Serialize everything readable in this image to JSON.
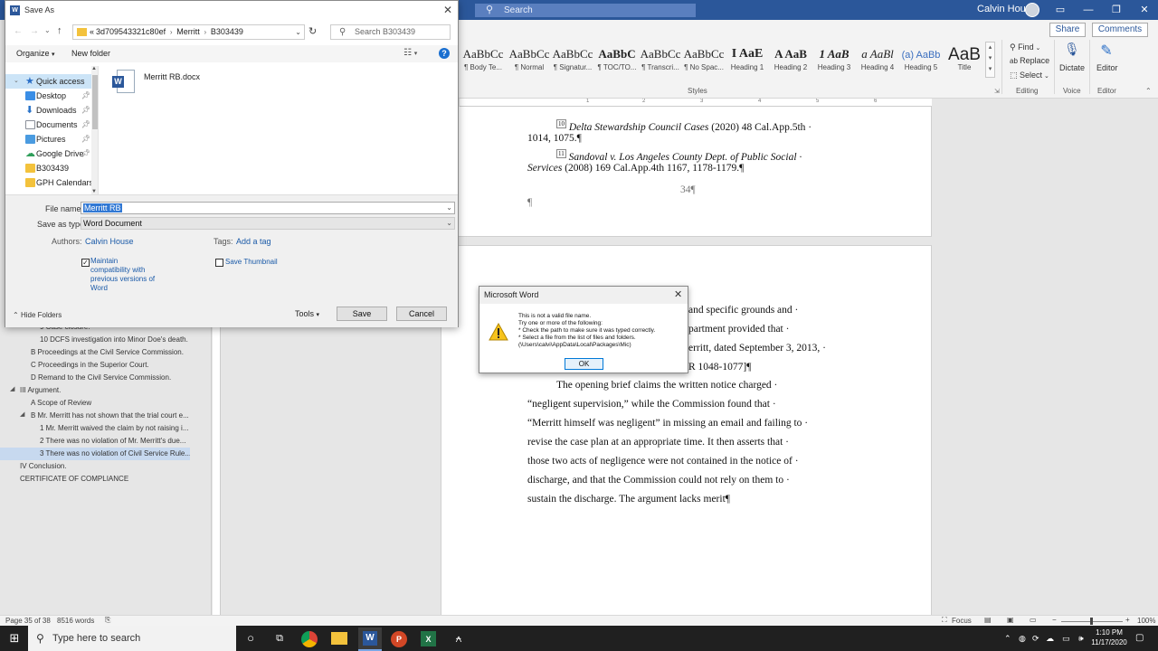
{
  "word": {
    "search_placeholder": "Search",
    "user_name": "Calvin House",
    "share": "Share",
    "comments": "Comments",
    "styles": [
      {
        "preview": "AaBbCc",
        "name": "¶ Body Te..."
      },
      {
        "preview": "AaBbCc",
        "name": "¶ Normal"
      },
      {
        "preview": "AaBbCc",
        "name": "¶ Signatur..."
      },
      {
        "preview": "AaBbC",
        "name": "¶ TOC/TO..."
      },
      {
        "preview": "AaBbCc",
        "name": "¶ Transcri..."
      },
      {
        "preview": "AaBbCc",
        "name": "¶ No Spac..."
      },
      {
        "preview": "I AaE",
        "name": "Heading 1"
      },
      {
        "preview": "A AaB",
        "name": "Heading 2"
      },
      {
        "preview": "1 AaB",
        "name": "Heading 3"
      },
      {
        "preview": "a AaBl",
        "name": "Heading 4"
      },
      {
        "preview": "(a) AaBb",
        "name": "Heading 5"
      },
      {
        "preview": "AaB",
        "name": "Title"
      }
    ],
    "styles_group": "Styles",
    "find": "Find",
    "replace": "Replace",
    "select": "Select",
    "editing_group": "Editing",
    "dictate": "Dictate",
    "voice_group": "Voice",
    "editor": "Editor",
    "editor_group": "Editor",
    "ruler_marks": [
      "1",
      "2",
      "3",
      "4",
      "5",
      "6"
    ]
  },
  "nav": {
    "items": [
      {
        "text": "9 Case closure.",
        "indent": 44
      },
      {
        "text": "10 DCFS investigation into Minor Doe's death.",
        "indent": 44
      },
      {
        "text": "B Proceedings at the Civil Service Commission.",
        "indent": 34
      },
      {
        "text": "C Proceedings in the Superior Court.",
        "indent": 34
      },
      {
        "text": "D Remand to the Civil Service Commission.",
        "indent": 34
      },
      {
        "text": "III Argument.",
        "indent": 22
      },
      {
        "text": "A Scope of Review",
        "indent": 34
      },
      {
        "text": "B Mr. Merritt has not shown that the trial court e...",
        "indent": 34
      },
      {
        "text": "1 Mr. Merritt waived the claim by not raising i...",
        "indent": 44
      },
      {
        "text": "2 There was no violation of Mr. Merritt's due...",
        "indent": 44
      },
      {
        "text": "3 There was no violation of Civil Service Rule...",
        "indent": 44
      },
      {
        "text": "IV Conclusion.",
        "indent": 22
      },
      {
        "text": "CERTIFICATE OF COMPLIANCE",
        "indent": 22
      }
    ]
  },
  "document": {
    "page1": {
      "fn10_num": "10",
      "fn10_case": "Delta Stewardship Council Cases",
      "fn10_cite": " (2020) 48 Cal.App.5th ·",
      "fn10_cont": "1014, 1075.¶",
      "fn11_num": "11",
      "fn11_case": "Sandoval v. Los Angeles County Dept. of Public Social ·",
      "fn11_case2": "Services",
      "fn11_cite": " (2008) 169 Cal.App.4th 1167, 1178-1179.¶",
      "page_number": "34¶",
      "pilcrow": "¶"
    },
    "page2": {
      "lines": [
        "and specific grounds and ·",
        "partment provided that ·",
        "erritt, dated September 3, 2013, ·",
        "R 1048-1077]¶"
      ],
      "paragraph": [
        "The opening brief claims the written notice charged ·",
        "“negligent supervision,” while the Commission found that ·",
        "“Merritt himself was negligent” in missing an email and failing to ·",
        "revise the case plan at an appropriate time. It then asserts that ·",
        "those two acts of negligence were not contained in the notice of ·",
        "discharge, and that the Commission could not rely on them to ·",
        "sustain the discharge. The argument lacks merit¶"
      ]
    }
  },
  "status": {
    "page": "Page 35 of 38",
    "words": "8516 words",
    "focus": "Focus",
    "zoom": "100%"
  },
  "taskbar": {
    "search_placeholder": "Type here to search",
    "time": "1:10 PM",
    "date": "11/17/2020"
  },
  "save_dialog": {
    "title": "Save As",
    "breadcrumb": [
      "3d709543321c80ef",
      "Merritt",
      "B303439"
    ],
    "search_placeholder": "Search B303439",
    "organize": "Organize",
    "new_folder": "New folder",
    "quick_access": [
      {
        "label": "Quick access",
        "icon": "star-icon",
        "color": "#2b6fc7"
      },
      {
        "label": "Desktop",
        "icon": "desktop-icon",
        "color": "#3a8ee6"
      },
      {
        "label": "Downloads",
        "icon": "download-icon",
        "color": "#2a73c9"
      },
      {
        "label": "Documents",
        "icon": "documents-icon",
        "color": "#8a8f99"
      },
      {
        "label": "Pictures",
        "icon": "pictures-icon",
        "color": "#4a9be0"
      },
      {
        "label": "Google Drive",
        "icon": "google-drive-icon",
        "color": "#2f9e5a"
      },
      {
        "label": "B303439",
        "icon": "folder-icon",
        "color": "#f3c23c"
      },
      {
        "label": "GPH Calendars",
        "icon": "folder-icon",
        "color": "#f3c23c"
      }
    ],
    "file": "Merritt RB.docx",
    "file_name_label": "File name:",
    "file_name_value": "Merritt RB",
    "save_as_type_label": "Save as type:",
    "save_as_type_value": "Word Document",
    "authors_label": "Authors:",
    "authors_value": "Calvin House",
    "tags_label": "Tags:",
    "tags_value": "Add a tag",
    "maintain_compat": [
      "Maintain",
      "compatibility with",
      "previous versions of",
      "Word"
    ],
    "maintain_checked": true,
    "save_thumbnail": "Save Thumbnail",
    "save_thumbnail_checked": false,
    "hide_folders": "Hide Folders",
    "tools": "Tools",
    "save": "Save",
    "cancel": "Cancel"
  },
  "message_box": {
    "title": "Microsoft Word",
    "lines": [
      "This is not a valid file name.",
      "Try one or more of the following:",
      "* Check the path to make sure it was typed correctly.",
      "* Select a file from the list of files and folders.",
      "(\\Users\\calvi\\AppData\\Local\\Packages\\Mic)"
    ],
    "ok": "OK"
  }
}
